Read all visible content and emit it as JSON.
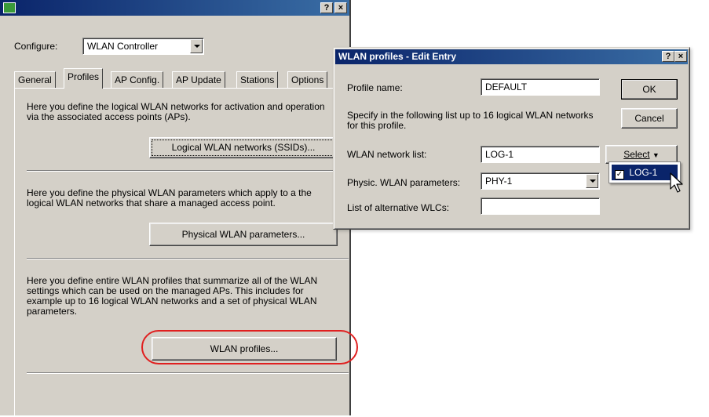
{
  "main_window": {
    "configure_label": "Configure:",
    "configure_value": "WLAN Controller",
    "tabs": [
      "General",
      "Profiles",
      "AP Config.",
      "AP Update",
      "Stations",
      "Options"
    ],
    "section1_text": "Here you define the logical WLAN networks for activation and operation via the associated access points (APs).",
    "section1_button": "Logical WLAN networks (SSIDs)...",
    "section2_text": "Here you define the physical WLAN parameters which apply to a the logical WLAN networks that share a managed access point.",
    "section2_button": "Physical WLAN parameters...",
    "section3_text": "Here you define entire WLAN profiles that summarize all of the WLAN settings which can be used on the managed APs. This includes for example up to 16 logical WLAN networks and a set of physical WLAN parameters.",
    "section3_button": "WLAN profiles...",
    "help_btn": "?",
    "close_btn": "×"
  },
  "dialog": {
    "title": "WLAN profiles - Edit Entry",
    "help_btn": "?",
    "close_btn": "×",
    "profile_name_label": "Profile name:",
    "profile_name_value": "DEFAULT",
    "hint_text": "Specify in the following list up to 16 logical WLAN networks for this profile.",
    "network_list_label": "WLAN network list:",
    "network_list_value": "LOG-1",
    "phys_label": "Physic. WLAN parameters:",
    "phys_value": "PHY-1",
    "alt_wlc_label": "List of alternative WLCs:",
    "alt_wlc_value": "",
    "ok_button": "OK",
    "cancel_button": "Cancel",
    "select_button": "Select",
    "select_popup_item": "LOG-1"
  },
  "colors": {
    "window_bg": "#d4d0c8",
    "title_bar": "#0a246a",
    "highlight": "#0a246a",
    "annotation_red": "#e02020"
  }
}
